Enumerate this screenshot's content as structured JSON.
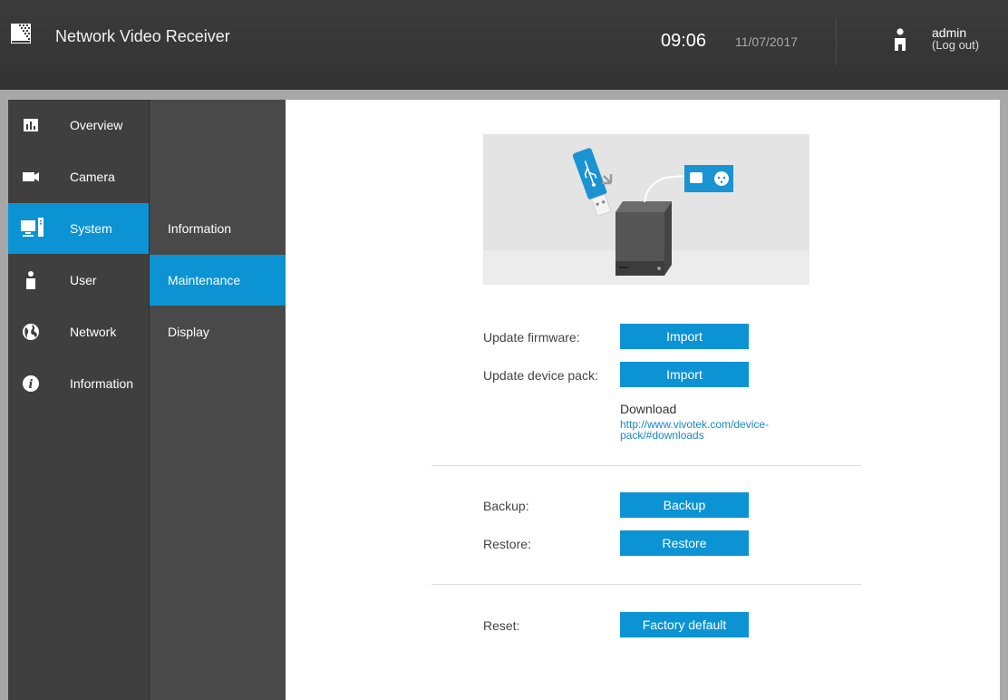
{
  "header": {
    "app_title": "Network Video Receiver",
    "time": "09:06",
    "date": "11/07/2017",
    "user": "admin",
    "logout": "(Log out)",
    "logo_icon": "grid-logo-icon",
    "user_icon": "person-icon"
  },
  "sidebar": {
    "items": [
      {
        "label": "Overview",
        "icon": "chart-icon",
        "active": false
      },
      {
        "label": "Camera",
        "icon": "video-camera-icon",
        "active": false
      },
      {
        "label": "System",
        "icon": "computer-icon",
        "active": true
      },
      {
        "label": "User",
        "icon": "person-icon",
        "active": false
      },
      {
        "label": "Network",
        "icon": "globe-icon",
        "active": false
      },
      {
        "label": "Information",
        "icon": "info-icon",
        "active": false
      }
    ]
  },
  "subnav": {
    "items": [
      {
        "label": "Information",
        "active": false
      },
      {
        "label": "Maintenance",
        "active": true
      },
      {
        "label": "Display",
        "active": false
      }
    ]
  },
  "maintenance": {
    "update_firmware_label": "Update firmware:",
    "update_firmware_button": "Import",
    "update_device_pack_label": "Update device pack:",
    "update_device_pack_button": "Import",
    "download_label": "Download",
    "download_link_line1": "http://www.vivotek.com/device-",
    "download_link_line2": "pack/#downloads",
    "backup_label": "Backup:",
    "backup_button": "Backup",
    "restore_label": "Restore:",
    "restore_button": "Restore",
    "reset_label": "Reset:",
    "reset_button": "Factory default"
  },
  "colors": {
    "accent": "#0c93d3",
    "header_bg": "#383838",
    "sidebar_bg": "#3f3f3f",
    "subnav_bg": "#494949"
  }
}
